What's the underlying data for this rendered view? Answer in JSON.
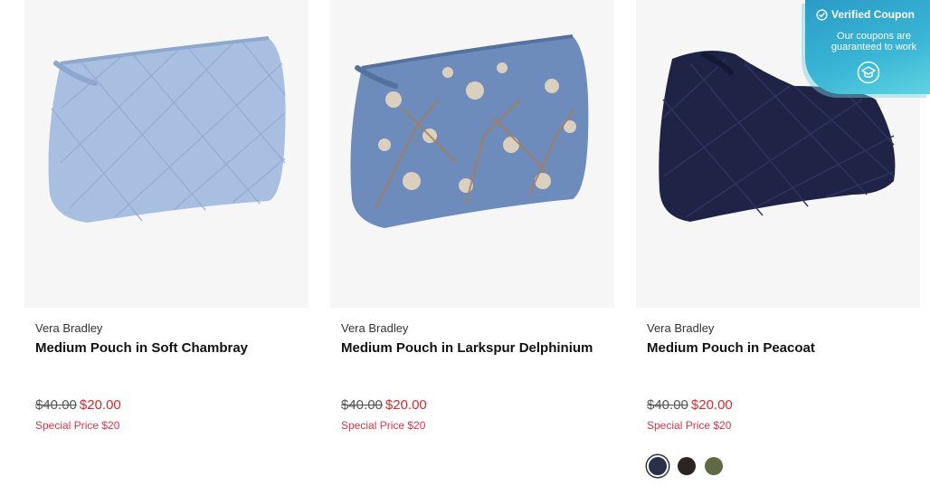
{
  "products": [
    {
      "brand": "Vera Bradley",
      "title": "Medium Pouch in Soft Chambray",
      "old_price": "$40.00",
      "new_price": "$20.00",
      "special": "Special Price $20",
      "color": "#a9bfe2"
    },
    {
      "brand": "Vera Bradley",
      "title": "Medium Pouch in Larkspur Delphinium",
      "old_price": "$40.00",
      "new_price": "$20.00",
      "special": "Special Price $20",
      "color": "#6d8cbc"
    },
    {
      "brand": "Vera Bradley",
      "title": "Medium Pouch in Peacoat",
      "old_price": "$40.00",
      "new_price": "$20.00",
      "special": "Special Price $20",
      "color": "#1f2447",
      "swatches": [
        "#2a2f4a",
        "#2a2422",
        "#5e6b42"
      ]
    }
  ],
  "badge": {
    "title": "Verified Coupon",
    "text": "Our coupons are guaranteed to work"
  }
}
